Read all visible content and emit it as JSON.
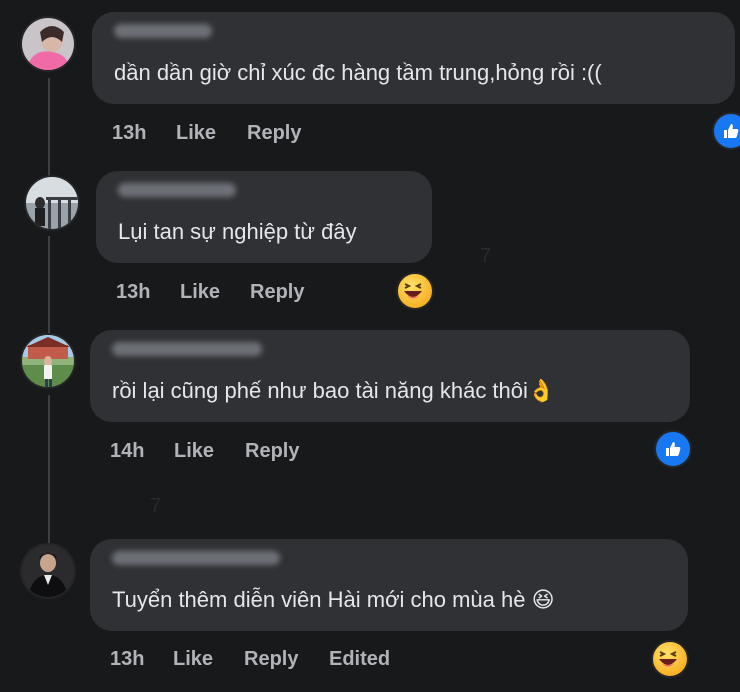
{
  "comments": [
    {
      "text": "dần dần giờ chỉ xúc đc hàng tầm trung,hỏng rồi :((",
      "time": "13h",
      "like": "Like",
      "reply": "Reply",
      "reaction": "like"
    },
    {
      "text": "Lụi tan sự nghiệp từ đây",
      "time": "13h",
      "like": "Like",
      "reply": "Reply",
      "reaction": "haha"
    },
    {
      "text": "rồi lại cũng phế như bao tài năng khác thôi👌",
      "time": "14h",
      "like": "Like",
      "reply": "Reply",
      "reaction": "like"
    },
    {
      "text": "Tuyển thêm diễn viên Hài mới cho mùa hè 😆",
      "time": "13h",
      "like": "Like",
      "reply": "Reply",
      "edited": "Edited",
      "reaction": "haha"
    }
  ],
  "colors": {
    "background": "#18191a",
    "bubble": "#303134",
    "action_text": "#b0b3b8",
    "like_blue": "#1877f2"
  }
}
